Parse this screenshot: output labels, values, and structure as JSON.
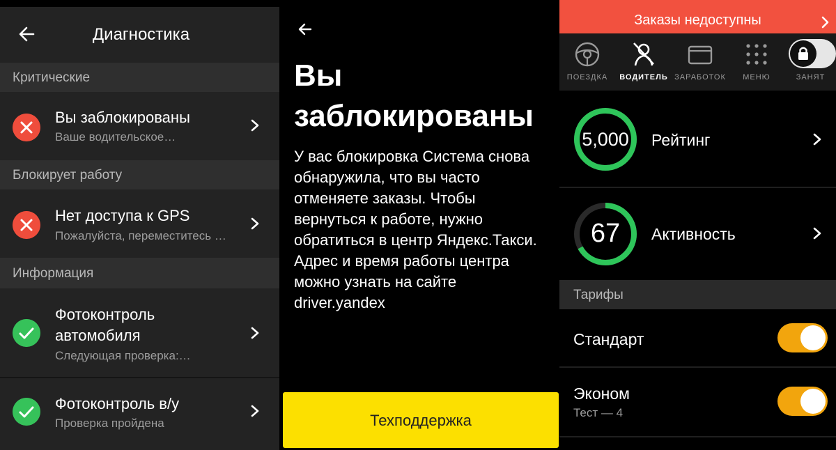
{
  "diagnostics": {
    "title": "Диагностика",
    "sections": [
      {
        "header": "Критические",
        "items": [
          {
            "title": "Вы заблокированы",
            "subtitle": "Ваше водительское…",
            "status": "error"
          }
        ]
      },
      {
        "header": "Блокирует работу",
        "items": [
          {
            "title": "Нет доступа к GPS",
            "subtitle": "Пожалуйста, переместитесь …",
            "status": "error"
          }
        ]
      },
      {
        "header": "Информация",
        "items": [
          {
            "title_line1": "Фотоконтроль",
            "title_line2": "автомобиля",
            "subtitle": "Следующая проверка:…",
            "status": "ok"
          },
          {
            "title": "Фотоконтроль в/у",
            "subtitle": "Проверка пройдена",
            "status": "ok"
          }
        ]
      }
    ]
  },
  "blocked": {
    "title_line1": "Вы",
    "title_line2": "заблокированы",
    "text_lines": [
      "У вас блокировка Система снова",
      "обнаружила, что вы часто",
      "отменяете заказы. Чтобы",
      "вернуться к работе, нужно",
      "обратиться в центр Яндекс.Такси.",
      "Адрес и время работы центра",
      "можно узнать на сайте",
      "driver.yandex"
    ],
    "support_button": "Техподдержка"
  },
  "driver": {
    "banner": "Заказы недоступны",
    "nav": [
      {
        "label": "ПОЕЗДКА",
        "icon": "steering-wheel-icon",
        "active": false
      },
      {
        "label": "ВОДИТЕЛЬ",
        "icon": "driver-icon",
        "active": true
      },
      {
        "label": "ЗАРАБОТОК",
        "icon": "wallet-icon",
        "active": false
      },
      {
        "label": "МЕНЮ",
        "icon": "menu-grid-icon",
        "active": false
      },
      {
        "label": "ЗАНЯТ",
        "icon": "lock-icon",
        "active": false
      }
    ],
    "rating": {
      "value": "5,000",
      "label": "Рейтинг",
      "fill": 1.0
    },
    "activity": {
      "value": "67",
      "label": "Активность",
      "fill": 0.67
    },
    "tariffs_header": "Тарифы",
    "tariffs": [
      {
        "name": "Стандарт",
        "subtitle": "",
        "enabled": true
      },
      {
        "name": "Эконом",
        "subtitle": "Тест — 4",
        "enabled": true
      }
    ]
  },
  "colors": {
    "error": "#ef4d3c",
    "ok": "#36c25a",
    "accent_yellow": "#fce000",
    "banner_red": "#f2513f",
    "toggle_orange": "#f2a50d",
    "ring_green": "#2ec55a"
  }
}
